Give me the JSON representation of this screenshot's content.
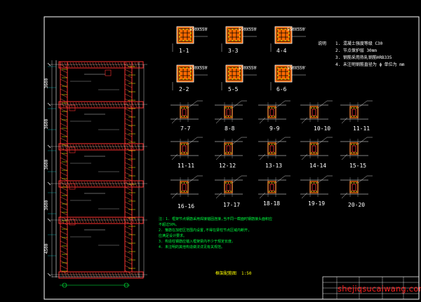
{
  "colors": {
    "background": "#000000",
    "frame": "#ffffff",
    "beam": "#ff3030",
    "hatch": "#ff6040",
    "column_fill": "#ff6a00",
    "rebar": "#ffff00",
    "note_text": "#00ff40",
    "grid": "#00ffff",
    "watermark": "#ff2020"
  },
  "sections_top": [
    {
      "label": "1-1",
      "dim": "550X550"
    },
    {
      "label": "3-3",
      "dim": "550X550"
    },
    {
      "label": "4-4",
      "dim": "550X550"
    },
    {
      "label": "2-2",
      "dim": "550X550"
    },
    {
      "label": "5-5",
      "dim": "550X550"
    },
    {
      "label": "6-6",
      "dim": "550X550"
    }
  ],
  "details": [
    {
      "label": "7-7"
    },
    {
      "label": "8-8"
    },
    {
      "label": "9-9"
    },
    {
      "label": "10-10"
    },
    {
      "label": "11-11"
    },
    {
      "label": "11-11"
    },
    {
      "label": "12-12"
    },
    {
      "label": "13-13"
    },
    {
      "label": "14-14"
    },
    {
      "label": "15-15"
    },
    {
      "label": "16-16"
    },
    {
      "label": "17-17"
    },
    {
      "label": "18-18"
    },
    {
      "label": "19-19"
    },
    {
      "label": "20-20"
    }
  ],
  "spec_notes": {
    "lead": "说明",
    "items": [
      "1. 混凝土强度等级  C30",
      "2. 节点保护层  30mm",
      "3. 钢筋采用热轧钢筋HRB335",
      "4. 未注明钢筋直径为  ϕ  单位为  mm"
    ]
  },
  "construction_notes": [
    "注：1. 框架节点钢筋采用焊接锚固连接,当不同一截面时钢筋接头面积应",
    "      不超过50%。",
    "    2. 箍筋在加密区范围内设置,不得在梁柱节点区域内断开,",
    "      应满足设计要求。",
    "    3. 构造柱钢筋应锚入框架梁内不少于规定长度。",
    "    4. 未注明的其他构造做法详见有关规范。"
  ],
  "elevation": {
    "title": "框架配筋图",
    "scale": "1:50",
    "level_dims": [
      "4500",
      "3600",
      "3600",
      "3600",
      "3600"
    ]
  },
  "watermark": "shejiqsucaiwang.com"
}
